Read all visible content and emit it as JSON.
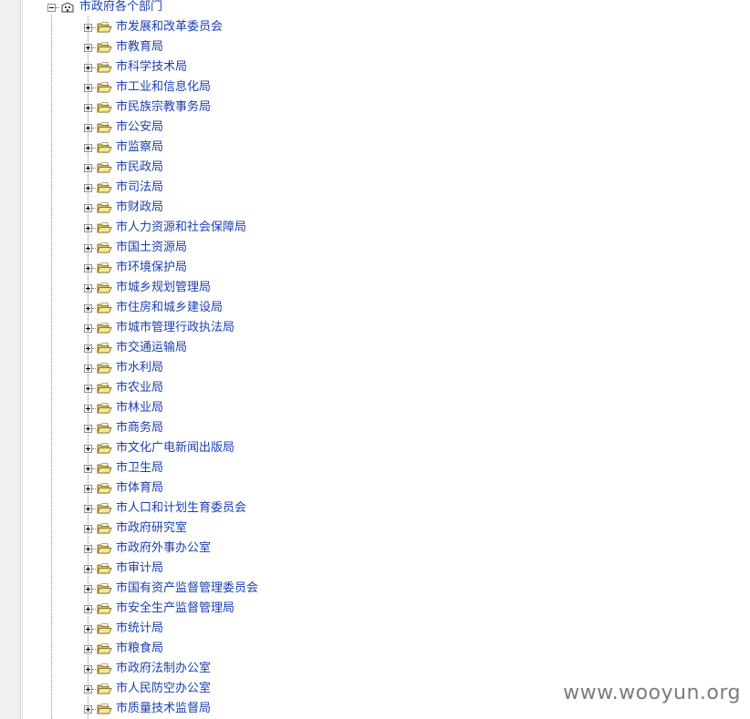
{
  "tree": {
    "root_label": "市政府各个部门",
    "children": [
      "市发展和改革委员会",
      "市教育局",
      "市科学技术局",
      "市工业和信息化局",
      "市民族宗教事务局",
      "市公安局",
      "市监察局",
      "市民政局",
      "市司法局",
      "市财政局",
      "市人力资源和社会保障局",
      "市国土资源局",
      "市环境保护局",
      "市城乡规划管理局",
      "市住房和城乡建设局",
      "市城市管理行政执法局",
      "市交通运输局",
      "市水利局",
      "市农业局",
      "市林业局",
      "市商务局",
      "市文化广电新闻出版局",
      "市卫生局",
      "市体育局",
      "市人口和计划生育委员会",
      "市政府研究室",
      "市政府外事办公室",
      "市审计局",
      "市国有资产监督管理委员会",
      "市安全生产监督管理局",
      "市统计局",
      "市粮食局",
      "市政府法制办公室",
      "市人民防空办公室",
      "市质量技术监督局"
    ]
  },
  "watermark": "www.wooyun.org",
  "colors": {
    "link": "#1c3fb0",
    "folder": "#f2dc7a",
    "folder_outline": "#6b5a12",
    "tree_line": "#8a8a8a"
  },
  "icons": {
    "root": "building-icon",
    "child": "open-folder-icon",
    "collapse": "minus-box-icon",
    "expand": "plus-box-icon"
  }
}
